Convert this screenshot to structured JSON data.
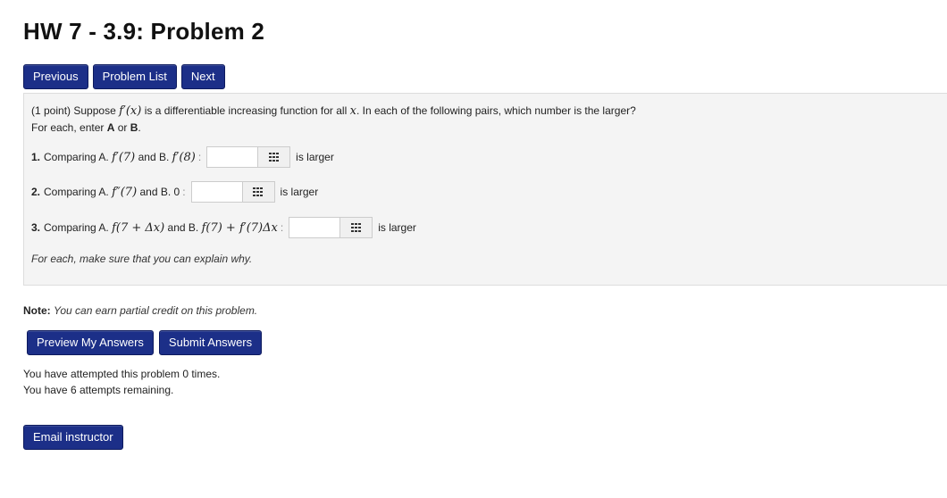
{
  "page": {
    "title": "HW 7 - 3.9: Problem 2"
  },
  "nav": {
    "previous": "Previous",
    "problem_list": "Problem List",
    "next": "Next"
  },
  "problem": {
    "points": "(1 point)",
    "intro_a": "Suppose",
    "intro_func": "f′(x)",
    "intro_b": "is a differentiable increasing function for all",
    "intro_var": "x",
    "intro_c": ". In each of the following pairs, which number is the larger?",
    "line2_a": "For each, enter",
    "line2_A": "A",
    "line2_or": "or",
    "line2_B": "B",
    "line2_end": ".",
    "questions": [
      {
        "num": "1.",
        "text_a": "Comparing A.",
        "expr_a": "f′(7)",
        "text_b": "and B.",
        "expr_b": "f′(8)",
        "colon": ":",
        "value": "",
        "suffix": "is larger"
      },
      {
        "num": "2.",
        "text_a": "Comparing A.",
        "expr_a": "f″(7)",
        "text_b": "and B. 0",
        "expr_b": "",
        "colon": ":",
        "value": "",
        "suffix": "is larger"
      },
      {
        "num": "3.",
        "text_a": "Comparing A.",
        "expr_a": "f(7 + Δx)",
        "text_b": "and B.",
        "expr_b": "f(7) + f′(7)Δx",
        "colon": ":",
        "value": "",
        "suffix": "is larger"
      }
    ],
    "explain": "For each, make sure that you can explain why."
  },
  "note": {
    "label": "Note:",
    "text": "You can earn partial credit on this problem."
  },
  "actions": {
    "preview": "Preview My Answers",
    "submit": "Submit Answers"
  },
  "attempts": {
    "line1": "You have attempted this problem 0 times.",
    "line2": "You have 6 attempts remaining."
  },
  "email": {
    "label": "Email instructor"
  },
  "colors": {
    "button_bg": "#1c2f88",
    "panel_bg": "#f4f4f4"
  }
}
